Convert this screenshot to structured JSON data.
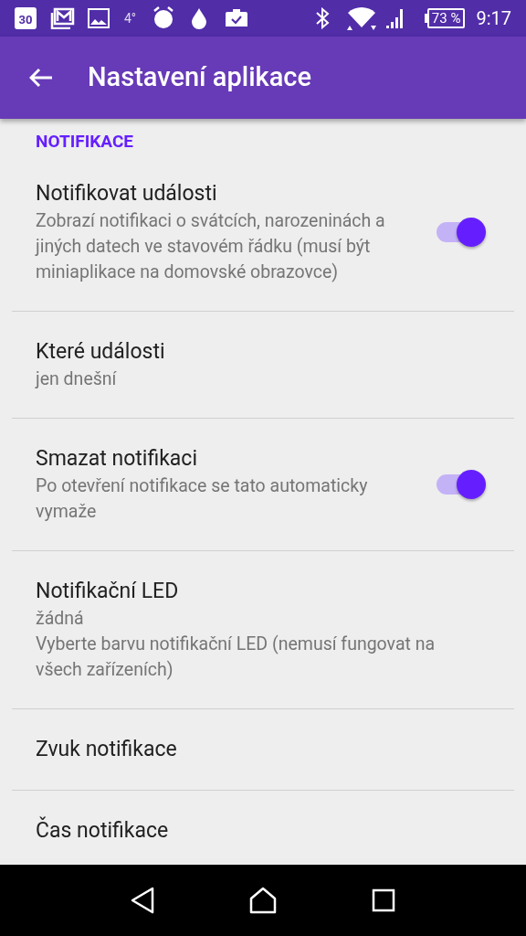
{
  "status_bar": {
    "calendar_day": "30",
    "temperature": "4°",
    "battery": "73 %",
    "time": "9:17"
  },
  "app_bar": {
    "title": "Nastavení aplikace"
  },
  "section": {
    "title": "NOTIFIKACE"
  },
  "settings": [
    {
      "kind": "switch",
      "title": "Notifikovat události",
      "summary": [
        "Zobrazí notifikaci o svátcích, narozeninách a jiných datech ve stavovém řádku (musí být miniaplikace na domovské obrazovce)"
      ],
      "checked": true
    },
    {
      "kind": "plain",
      "title": "Které události",
      "summary": [
        "jen dnešní"
      ]
    },
    {
      "kind": "switch",
      "title": "Smazat notifikaci",
      "summary": [
        "Po otevření notifikace se tato automaticky vymaže"
      ],
      "checked": true
    },
    {
      "kind": "plain",
      "title": "Notifikační LED",
      "summary": [
        "žádná",
        "Vyberte barvu notifikační LED (nemusí fungovat na všech zařízeních)"
      ]
    },
    {
      "kind": "plain",
      "title": "Zvuk notifikace"
    },
    {
      "kind": "plain",
      "title": "Čas notifikace"
    }
  ]
}
